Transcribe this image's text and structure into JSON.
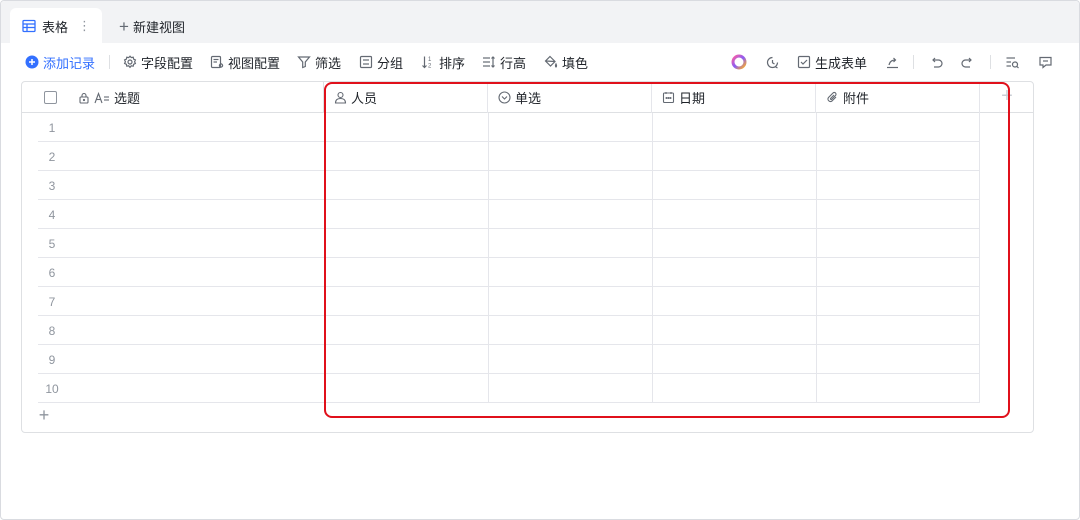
{
  "tabs": [
    {
      "label": "表格",
      "icon": "table-icon",
      "active": true
    }
  ],
  "new_view": {
    "label": "新建视图"
  },
  "toolbar": {
    "add_record": "添加记录",
    "field_config": "字段配置",
    "view_config": "视图配置",
    "filter": "筛选",
    "group": "分组",
    "sort": "排序",
    "row_height": "行高",
    "fill_color": "填色",
    "generate_form": "生成表单"
  },
  "columns": [
    {
      "label": "选题",
      "icon": "text-type-icon"
    },
    {
      "label": "人员",
      "icon": "person-icon"
    },
    {
      "label": "单选",
      "icon": "single-select-icon"
    },
    {
      "label": "日期",
      "icon": "calendar-icon"
    },
    {
      "label": "附件",
      "icon": "paperclip-icon"
    }
  ],
  "rows": [
    {
      "num": "1"
    },
    {
      "num": "2"
    },
    {
      "num": "3"
    },
    {
      "num": "4"
    },
    {
      "num": "5"
    },
    {
      "num": "6"
    },
    {
      "num": "7"
    },
    {
      "num": "8"
    },
    {
      "num": "9"
    },
    {
      "num": "10"
    }
  ],
  "colors": {
    "accent": "#3370ff",
    "highlight": "#e0101b"
  }
}
